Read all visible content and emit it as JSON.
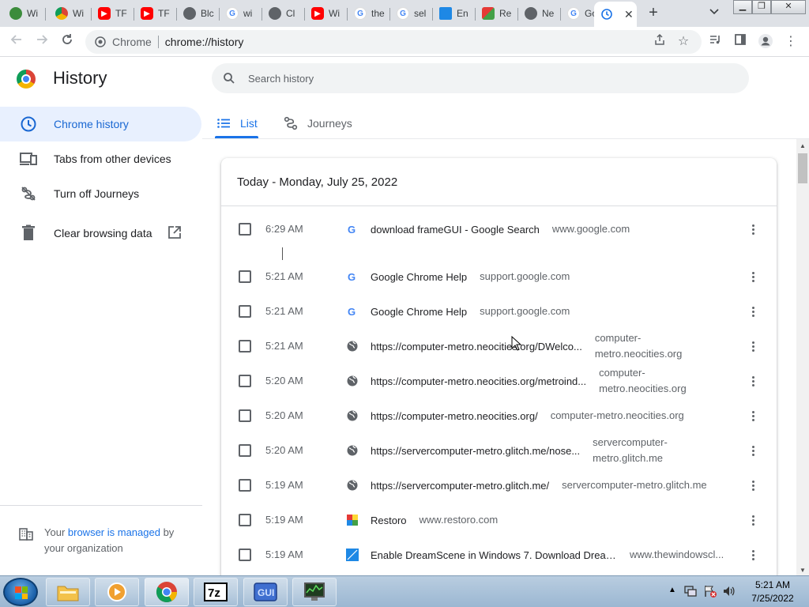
{
  "browser": {
    "tabs": [
      {
        "label": "Wi",
        "icon": "globe-icon",
        "color": "#3c8c3c"
      },
      {
        "label": "Wi",
        "icon": "chrome-icon",
        "color": "#4285f4"
      },
      {
        "label": "TF",
        "icon": "youtube-icon",
        "color": "#ff0000"
      },
      {
        "label": "TF",
        "icon": "youtube-icon",
        "color": "#ff0000"
      },
      {
        "label": "Blc",
        "icon": "globe-icon",
        "color": "#5f6368"
      },
      {
        "label": "wi",
        "icon": "google-icon",
        "color": "#4285f4"
      },
      {
        "label": "Cl",
        "icon": "globe-icon",
        "color": "#5f6368"
      },
      {
        "label": "Wi",
        "icon": "youtube-icon",
        "color": "#ff0000"
      },
      {
        "label": "the",
        "icon": "google-icon",
        "color": "#4285f4"
      },
      {
        "label": "sel",
        "icon": "google-icon",
        "color": "#4285f4"
      },
      {
        "label": "En",
        "icon": "dreamscene-icon",
        "color": "#1e88e5"
      },
      {
        "label": "Re",
        "icon": "restoro-icon",
        "color": "#e53935"
      },
      {
        "label": "Ne",
        "icon": "globe-icon",
        "color": "#5f6368"
      },
      {
        "label": "Go",
        "icon": "google-icon",
        "color": "#4285f4"
      },
      {
        "label": "",
        "icon": "history-icon",
        "color": "#1a73e8"
      }
    ],
    "omnibox": {
      "chip": "Chrome",
      "url": "chrome://history"
    }
  },
  "page": {
    "title": "History",
    "search_placeholder": "Search history"
  },
  "sidebar": {
    "items": [
      {
        "label": "Chrome history",
        "icon": "clock-icon"
      },
      {
        "label": "Tabs from other devices",
        "icon": "devices-icon"
      },
      {
        "label": "Turn off Journeys",
        "icon": "journeys-off-icon"
      },
      {
        "label": "Clear browsing data",
        "icon": "trash-icon"
      }
    ],
    "managed": {
      "prefix": "Your ",
      "link": "browser is managed",
      "suffix": " by your organization"
    }
  },
  "view_tabs": {
    "list": "List",
    "journeys": "Journeys"
  },
  "history": {
    "date_heading": "Today - Monday, July 25, 2022",
    "entries": [
      {
        "time": "6:29 AM",
        "icon": "google-icon",
        "title": "download frameGUI - Google Search",
        "domain": "www.google.com"
      },
      {
        "time": "5:21 AM",
        "icon": "google-icon",
        "title": "Google Chrome Help",
        "domain": "support.google.com"
      },
      {
        "time": "5:21 AM",
        "icon": "google-icon",
        "title": "Google Chrome Help",
        "domain": "support.google.com"
      },
      {
        "time": "5:21 AM",
        "icon": "globe-icon",
        "title": "https://computer-metro.neocities.org/DWelco...",
        "domain": "computer-metro.neocities.org"
      },
      {
        "time": "5:20 AM",
        "icon": "globe-icon",
        "title": "https://computer-metro.neocities.org/metroind...",
        "domain": "computer-metro.neocities.org"
      },
      {
        "time": "5:20 AM",
        "icon": "globe-icon",
        "title": "https://computer-metro.neocities.org/",
        "domain": "computer-metro.neocities.org"
      },
      {
        "time": "5:20 AM",
        "icon": "globe-icon",
        "title": "https://servercomputer-metro.glitch.me/nose...",
        "domain": "servercomputer-metro.glitch.me"
      },
      {
        "time": "5:19 AM",
        "icon": "globe-icon",
        "title": "https://servercomputer-metro.glitch.me/",
        "domain": "servercomputer-metro.glitch.me"
      },
      {
        "time": "5:19 AM",
        "icon": "restoro-icon",
        "title": "Restoro",
        "domain": "www.restoro.com"
      },
      {
        "time": "5:19 AM",
        "icon": "dreamscene-icon",
        "title": "Enable DreamScene in Windows 7. Download Dream...",
        "domain": "www.thewindowscl..."
      }
    ]
  },
  "taskbar": {
    "apps": [
      {
        "name": "explorer",
        "icon": "folder-icon"
      },
      {
        "name": "media-player",
        "icon": "media-player-icon"
      },
      {
        "name": "chrome",
        "icon": "chrome-icon"
      },
      {
        "name": "7-zip",
        "icon": "7zip-icon",
        "text": "7z"
      },
      {
        "name": "framegui",
        "icon": "gui-icon",
        "text": "GUI"
      },
      {
        "name": "task-manager",
        "icon": "monitor-icon"
      }
    ],
    "clock_time": "5:21 AM",
    "clock_date": "7/25/2022"
  }
}
